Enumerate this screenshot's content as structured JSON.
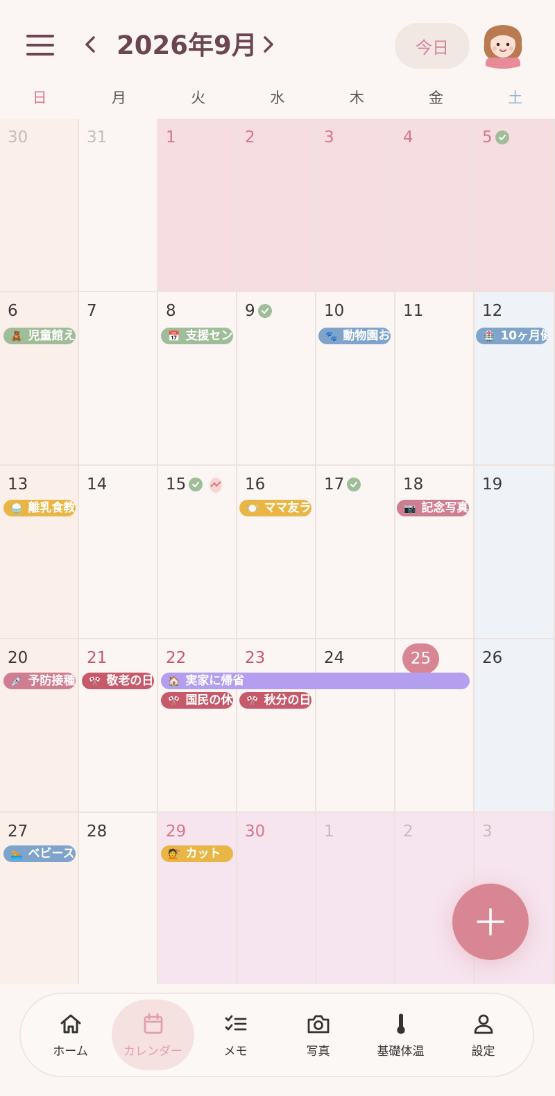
{
  "header": {
    "month_title": "2026年9月",
    "today_label": "今日"
  },
  "weekdays": [
    "日",
    "月",
    "火",
    "水",
    "木",
    "金",
    "土"
  ],
  "weekday_colors": [
    "#d9758a",
    "#555555",
    "#555555",
    "#555555",
    "#555555",
    "#555555",
    "#8fb2d8"
  ],
  "weeks": [
    [
      "30",
      "31",
      "1",
      "2",
      "3",
      "4",
      "5"
    ],
    [
      "6",
      "7",
      "8",
      "9",
      "10",
      "11",
      "12"
    ],
    [
      "13",
      "14",
      "15",
      "16",
      "17",
      "18",
      "19"
    ],
    [
      "20",
      "21",
      "22",
      "23",
      "24",
      "25",
      "26"
    ],
    [
      "27",
      "28",
      "29",
      "30",
      "1",
      "2",
      "3"
    ]
  ],
  "events": {
    "jidoukan": {
      "icon": "🧸",
      "label": "児童館え"
    },
    "shien": {
      "icon": "📅",
      "label": "支援セン"
    },
    "doubutsuen": {
      "icon": "🐾",
      "label": "動物園お"
    },
    "ten_month": {
      "icon": "🏥",
      "label": "10ヶ月健"
    },
    "rinyushoku": {
      "icon": "🍚",
      "label": "離乳食教"
    },
    "mamatomo": {
      "icon": "🍽️",
      "label": "ママ友ラ"
    },
    "kinen": {
      "icon": "📷",
      "label": "記念写真"
    },
    "yobou": {
      "icon": "💉",
      "label": "予防接種"
    },
    "keirou": {
      "icon": "🎌",
      "label": "敬老の日"
    },
    "jikka": {
      "icon": "🏠",
      "label": "実家に帰省"
    },
    "kokumin": {
      "icon": "🎌",
      "label": "国民の休"
    },
    "shubun": {
      "icon": "🎌",
      "label": "秋分の日"
    },
    "baby": {
      "icon": "🏊",
      "label": "ベビース"
    },
    "cut": {
      "icon": "💇",
      "label": "カット"
    }
  },
  "colors": {
    "green": "#9fbd98",
    "blue": "#7fa4cc",
    "yellow": "#e9b646",
    "rose": "#cf7d90",
    "red": "#c65a6a",
    "purple": "#b39ef0",
    "accent": "#d98694"
  },
  "bottom_nav": [
    {
      "label": "ホーム",
      "icon": "home-icon"
    },
    {
      "label": "カレンダー",
      "icon": "calendar-icon"
    },
    {
      "label": "メモ",
      "icon": "checklist-icon"
    },
    {
      "label": "写真",
      "icon": "camera-icon"
    },
    {
      "label": "基礎体温",
      "icon": "thermometer-icon"
    },
    {
      "label": "設定",
      "icon": "person-icon"
    }
  ]
}
